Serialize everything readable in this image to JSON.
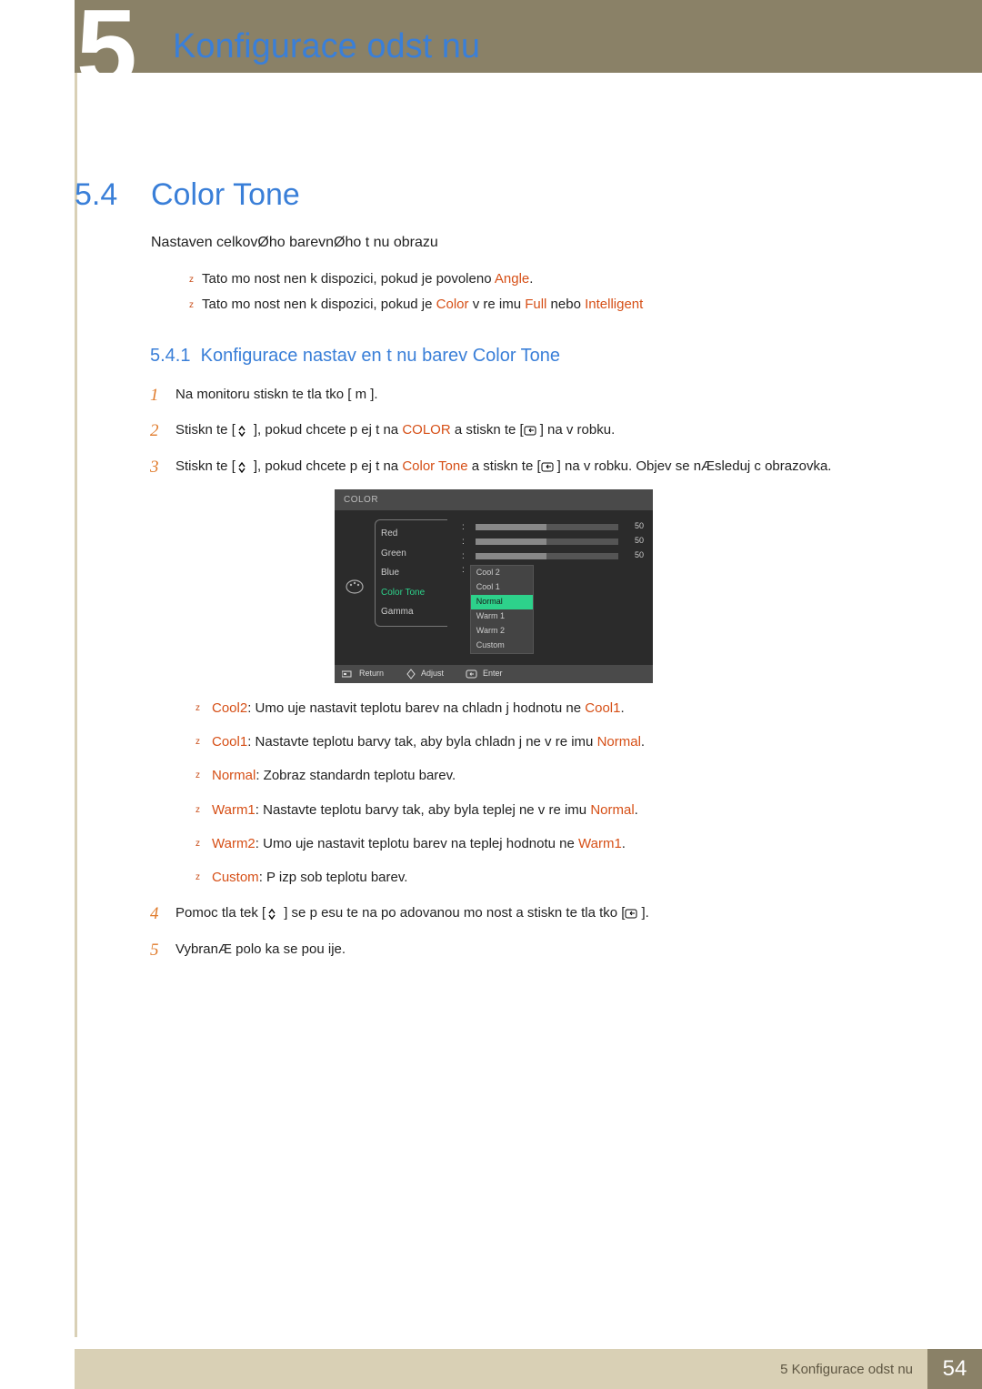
{
  "chapter": {
    "big_number": "5",
    "title": "Konfigurace odst nu"
  },
  "section": {
    "number": "5.4",
    "title": "Color Tone",
    "intro": "Nastaven  celkovØho barevnØho t nu obrazu"
  },
  "notes": {
    "n1_pre": "Tato mo nost nen  k dispozici, pokud je povoleno ",
    "n1_hl": "Angle",
    "n2_pre": "Tato mo nost nen  k dispozici, pokud je ",
    "n2_hl1": "Color",
    "n2_mid1": " v re imu ",
    "n2_hl2": "Full",
    "n2_mid2": " nebo ",
    "n2_hl3": "Intelligent"
  },
  "subsection": {
    "number": "5.4.1",
    "title": "Konfigurace nastav en  t nu barev Color Tone"
  },
  "steps": {
    "s1": "Na monitoru stiskn te tla  tko [ m ].",
    "s2_pre": "Stiskn te [",
    "s2_mid1": "], pokud chcete p ej t na ",
    "s2_hl": "COLOR",
    "s2_mid2": " a stiskn te [",
    "s2_post": "] na v robku.",
    "s3_pre": "Stiskn te [",
    "s3_mid1": "], pokud chcete p ej t na ",
    "s3_hl": "Color Tone",
    "s3_mid2": " a stiskn te [",
    "s3_post": "] na v robku. Objev  se nÆsleduj c  obrazovka.",
    "s4_pre": "Pomoc  tla  tek [",
    "s4_mid": "] se p esu te na po adovanou mo nost a stiskn te tla  tko [",
    "s4_post": "].",
    "s5": "VybranÆ polo ka se pou ije."
  },
  "osd": {
    "header": "COLOR",
    "menu": {
      "red": "Red",
      "green": "Green",
      "blue": "Blue",
      "color_tone": "Color Tone",
      "gamma": "Gamma"
    },
    "values": {
      "red": "50",
      "green": "50",
      "blue": "50"
    },
    "dropdown": {
      "cool2": "Cool 2",
      "cool1": "Cool 1",
      "normal": "Normal",
      "warm1": "Warm 1",
      "warm2": "Warm 2",
      "custom": "Custom"
    },
    "footer": {
      "return": "Return",
      "adjust": "Adjust",
      "enter": "Enter"
    }
  },
  "tones": {
    "cool2_k": "Cool2",
    "cool2_t": ": Umo  uje nastavit teplotu barev na chladn j   hodnotu ne  ",
    "cool2_ref": "Cool1",
    "cool1_k": "Cool1",
    "cool1_t": ": Nastavte teplotu barvy tak, aby byla chladn j   ne  v re imu ",
    "cool1_ref": "Normal",
    "normal_k": "Normal",
    "normal_t": ": Zobraz  standardn  teplotu barev.",
    "warm1_k": "Warm1",
    "warm1_t": ": Nastavte teplotu barvy tak, aby byla teplej   ne  v re imu ",
    "warm1_ref": "Normal",
    "warm2_k": "Warm2",
    "warm2_t": ": Umo  uje nastavit teplotu barev na teplej   hodnotu ne  ",
    "warm2_ref": "Warm1",
    "custom_k": "Custom",
    "custom_t": ": P izp sob  teplotu barev."
  },
  "footer": {
    "label": "5 Konfigurace odst nu",
    "page": "54"
  },
  "chart_data": {
    "type": "table",
    "title": "COLOR OSD",
    "rows": [
      {
        "item": "Red",
        "value": 50
      },
      {
        "item": "Green",
        "value": 50
      },
      {
        "item": "Blue",
        "value": 50
      },
      {
        "item": "Color Tone",
        "options": [
          "Cool 2",
          "Cool 1",
          "Normal",
          "Warm 1",
          "Warm 2",
          "Custom"
        ],
        "selected": "Normal"
      },
      {
        "item": "Gamma",
        "value": null
      }
    ]
  }
}
